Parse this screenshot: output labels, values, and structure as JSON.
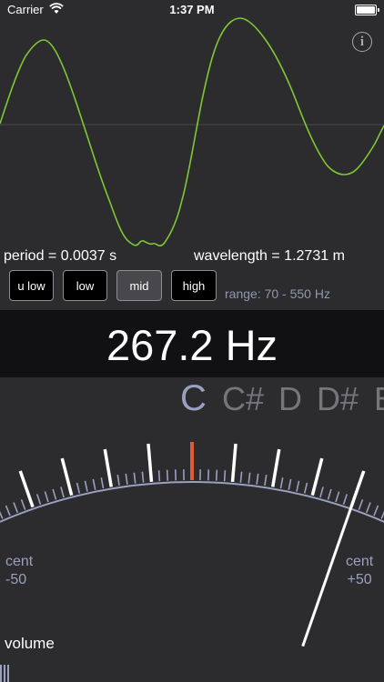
{
  "status_bar": {
    "carrier": "Carrier",
    "time": "1:37 PM"
  },
  "header": {
    "info_glyph": "i"
  },
  "readouts": {
    "period": "period = 0.0037 s",
    "wavelength": "wavelength = 1.2731 m"
  },
  "range_buttons": [
    {
      "label": "u low",
      "selected": false
    },
    {
      "label": "low",
      "selected": false
    },
    {
      "label": "mid",
      "selected": true
    },
    {
      "label": "high",
      "selected": false
    }
  ],
  "range_text": "range: 70 - 550 Hz",
  "frequency": "267.2 Hz",
  "notes": [
    "C",
    "C#",
    "D",
    "D#",
    "E"
  ],
  "current_note": "C",
  "meter": {
    "left_label_1": "cent",
    "left_label_2": "-50",
    "right_label_1": "cent",
    "right_label_2": "+50",
    "needle_cents": 40,
    "center_tick_color": "#e05a32",
    "scale_color": "#9aa0bf"
  },
  "volume_label": "volume",
  "colors": {
    "waveform": "#7ec832",
    "background": "#2c2c2e"
  }
}
